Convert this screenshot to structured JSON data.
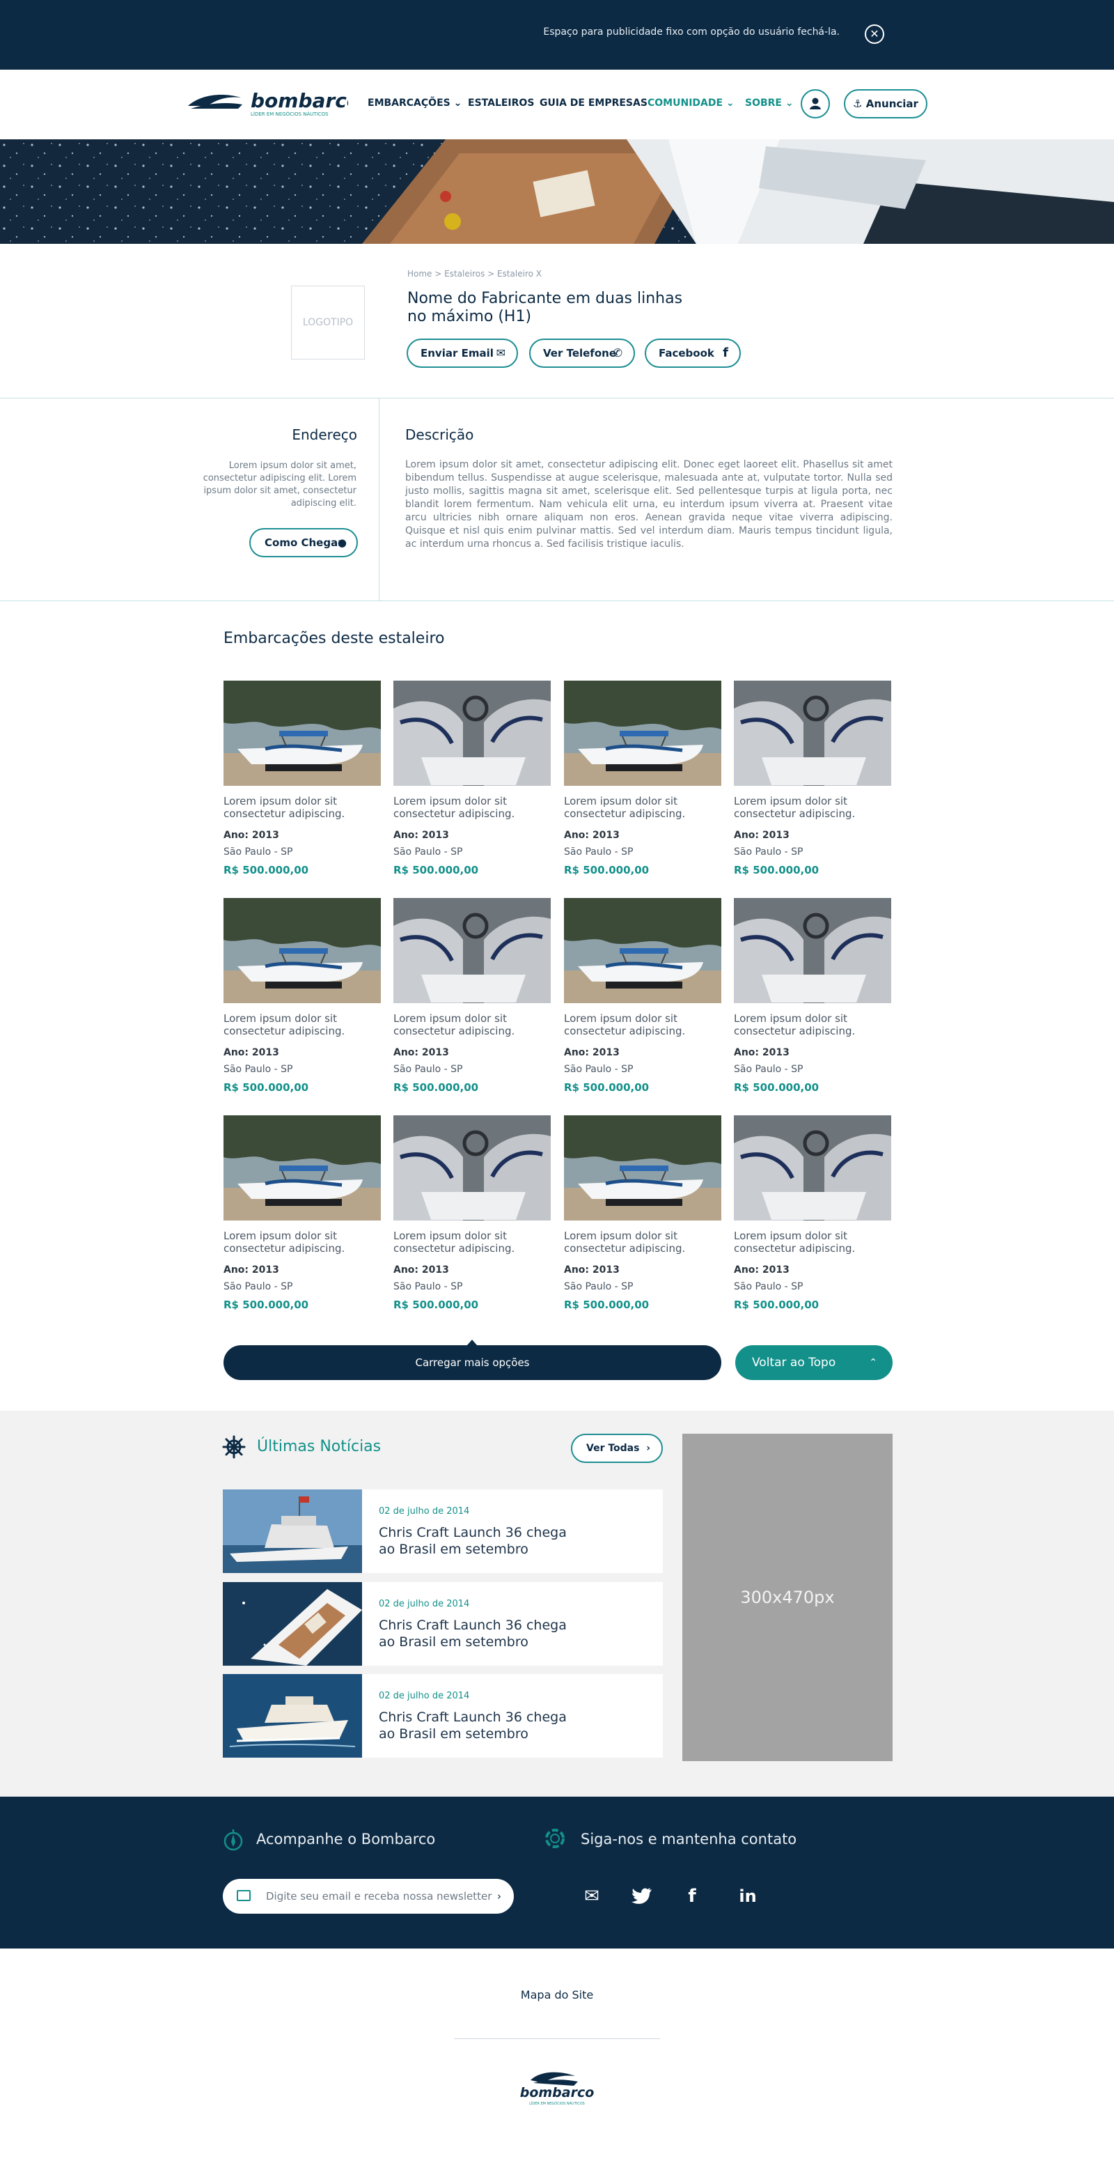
{
  "ad_bar": {
    "text": "Espaço para publicidade fixo com opção do usuário fechá-la.",
    "close_icon": "close-circle-icon"
  },
  "nav": {
    "logo_name": "bombarco",
    "logo_tagline": "LÍDER EM NEGÓCIOS NÁUTICOS",
    "items": [
      "EMBARCAÇÕES",
      "ESTALEIROS",
      "GUIA DE EMPRESAS",
      "COMUNIDADE",
      "SOBRE"
    ],
    "anunciar": "Anunciar"
  },
  "breadcrumb": "Home > Estaleiros > Estaleiro X",
  "logotipo": "LOGOTIPO",
  "manufacturer_title": "Nome do Fabricante em duas linhas no máximo (H1)",
  "actions": {
    "email": "Enviar Email",
    "phone": "Ver Telefone",
    "facebook": "Facebook"
  },
  "endereco": {
    "title": "Endereço",
    "text": "Lorem ipsum dolor sit amet, consectetur adipiscing elit. Lorem ipsum dolor sit amet, consectetur adipiscing elit.",
    "directions": "Como Chegar"
  },
  "descricao": {
    "title": "Descrição",
    "text": "Lorem ipsum dolor sit amet, consectetur adipiscing elit. Donec eget laoreet elit. Phasellus sit amet bibendum tellus. Suspendisse at augue scelerisque, malesuada ante at, vulputate tortor. Nulla sed justo mollis, sagittis magna sit amet, scelerisque elit. Sed pellentesque turpis at ligula porta, nec blandit lorem fermentum. Nam vehicula elit urna, eu interdum ipsum viverra at. Praesent vitae arcu ultricies nibh ornare aliquam non eros. Aenean gravida neque vitae viverra adipiscing. Quisque et nisl quis enim pulvinar mattis. Sed vel interdum diam. Mauris tempus tincidunt ligula, ac interdum urna rhoncus a. Sed facilisis tristique iaculis."
  },
  "listings_title": "Embarcações deste estaleiro",
  "listings": [
    {
      "title": "Lorem ipsum dolor sit consectetur adipiscing.",
      "year": "Ano: 2013",
      "location": "São Paulo - SP",
      "price": "R$ 500.000,00"
    },
    {
      "title": "Lorem ipsum dolor sit consectetur adipiscing.",
      "year": "Ano: 2013",
      "location": "São Paulo - SP",
      "price": "R$ 500.000,00"
    },
    {
      "title": "Lorem ipsum dolor sit consectetur adipiscing.",
      "year": "Ano: 2013",
      "location": "São Paulo - SP",
      "price": "R$ 500.000,00"
    },
    {
      "title": "Lorem ipsum dolor sit consectetur adipiscing.",
      "year": "Ano: 2013",
      "location": "São Paulo - SP",
      "price": "R$ 500.000,00"
    },
    {
      "title": "Lorem ipsum dolor sit consectetur adipiscing.",
      "year": "Ano: 2013",
      "location": "São Paulo - SP",
      "price": "R$ 500.000,00"
    },
    {
      "title": "Lorem ipsum dolor sit consectetur adipiscing.",
      "year": "Ano: 2013",
      "location": "São Paulo - SP",
      "price": "R$ 500.000,00"
    },
    {
      "title": "Lorem ipsum dolor sit consectetur adipiscing.",
      "year": "Ano: 2013",
      "location": "São Paulo - SP",
      "price": "R$ 500.000,00"
    },
    {
      "title": "Lorem ipsum dolor sit consectetur adipiscing.",
      "year": "Ano: 2013",
      "location": "São Paulo - SP",
      "price": "R$ 500.000,00"
    },
    {
      "title": "Lorem ipsum dolor sit consectetur adipiscing.",
      "year": "Ano: 2013",
      "location": "São Paulo - SP",
      "price": "R$ 500.000,00"
    },
    {
      "title": "Lorem ipsum dolor sit consectetur adipiscing.",
      "year": "Ano: 2013",
      "location": "São Paulo - SP",
      "price": "R$ 500.000,00"
    },
    {
      "title": "Lorem ipsum dolor sit consectetur adipiscing.",
      "year": "Ano: 2013",
      "location": "São Paulo - SP",
      "price": "R$ 500.000,00"
    },
    {
      "title": "Lorem ipsum dolor sit consectetur adipiscing.",
      "year": "Ano: 2013",
      "location": "São Paulo - SP",
      "price": "R$ 500.000,00"
    }
  ],
  "load_more": "Carregar mais opções",
  "back_to_top": "Voltar ao Topo",
  "news": {
    "title": "Últimas Notícias",
    "see_all": "Ver Todas",
    "items": [
      {
        "date": "02 de julho de 2014",
        "title": "Chris Craft Launch 36 chega ao Brasil em setembro"
      },
      {
        "date": "02 de julho de 2014",
        "title": "Chris Craft Launch 36 chega ao Brasil em setembro"
      },
      {
        "date": "02 de julho de 2014",
        "title": "Chris Craft Launch 36 chega ao Brasil em setembro"
      }
    ],
    "ad_label": "300x470px"
  },
  "footer": {
    "follow_title": "Acompanhe o Bombarco",
    "contact_title": "Siga-nos e mantenha contato",
    "newsletter_placeholder": "Digite seu email e receba nossa newsletter",
    "social_icons": [
      "mail-icon",
      "twitter-icon",
      "facebook-icon",
      "linkedin-icon"
    ],
    "site_map": "Mapa do Site"
  },
  "colors": {
    "navy": "#0c2a44",
    "teal": "#13908a",
    "grey_bg": "#f2f2f2",
    "ad_grey": "#a3a3a3"
  }
}
